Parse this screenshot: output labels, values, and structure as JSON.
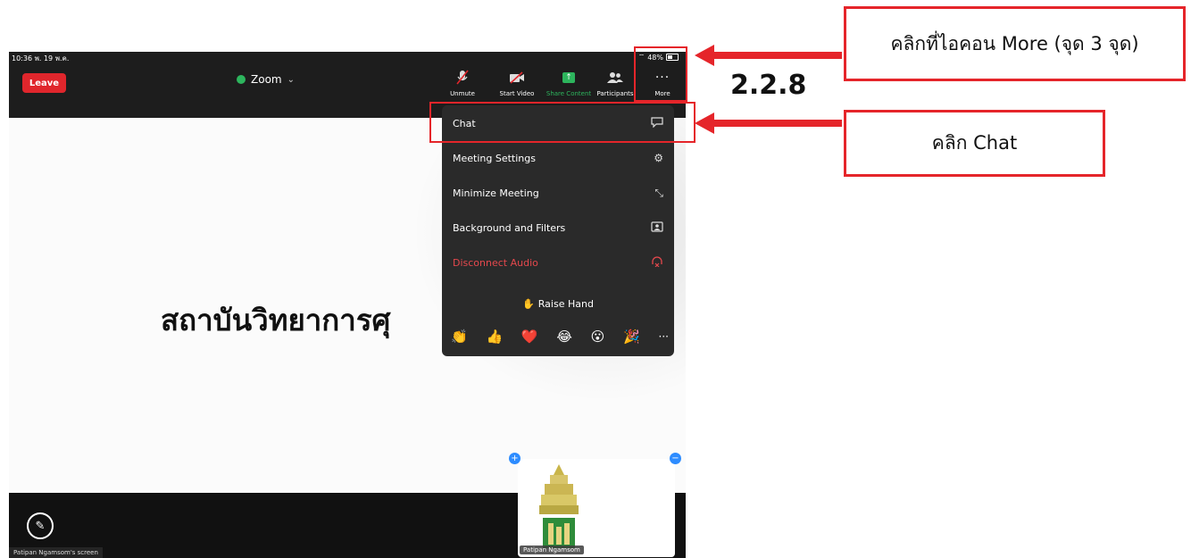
{
  "status_bar": {
    "time": "10:36",
    "date": "พ. 19 พ.ค.",
    "battery": "48%"
  },
  "toolbar": {
    "leave_label": "Leave",
    "meeting_title": "Zoom",
    "buttons": [
      {
        "label": "Unmute",
        "icon": "mic-off-icon"
      },
      {
        "label": "Start Video",
        "icon": "video-off-icon"
      },
      {
        "label": "Share Content",
        "icon": "share-icon"
      },
      {
        "label": "Participants",
        "icon": "participants-icon"
      },
      {
        "label": "More",
        "icon": "more-dots-icon"
      }
    ]
  },
  "menu": {
    "items": [
      {
        "label": "Chat",
        "icon": "chat-bubble-icon"
      },
      {
        "label": "Meeting Settings",
        "icon": "gear-icon"
      },
      {
        "label": "Minimize Meeting",
        "icon": "minimize-icon"
      },
      {
        "label": "Background and Filters",
        "icon": "background-icon"
      },
      {
        "label": "Disconnect Audio",
        "icon": "headphones-off-icon"
      }
    ],
    "raise_hand": "Raise Hand",
    "reactions": [
      "👏",
      "👍",
      "❤️",
      "😂",
      "😮",
      "🎉"
    ]
  },
  "stage": {
    "slide_text": "สถาบันวิทยาการศุ"
  },
  "thumbnail": {
    "name": "Patipan Ngamsom"
  },
  "screen_label": "Patipan Ngamsom's screen",
  "annotations": {
    "step": "2.2.8",
    "callout_more": "คลิกที่ไอคอน More (จุด 3 จุด)",
    "callout_chat": "คลิก Chat"
  },
  "colors": {
    "leave": "#e0262c",
    "zoom_green": "#2db55d",
    "annotation_red": "#e5252a",
    "zoom_blue": "#2d8cff"
  }
}
